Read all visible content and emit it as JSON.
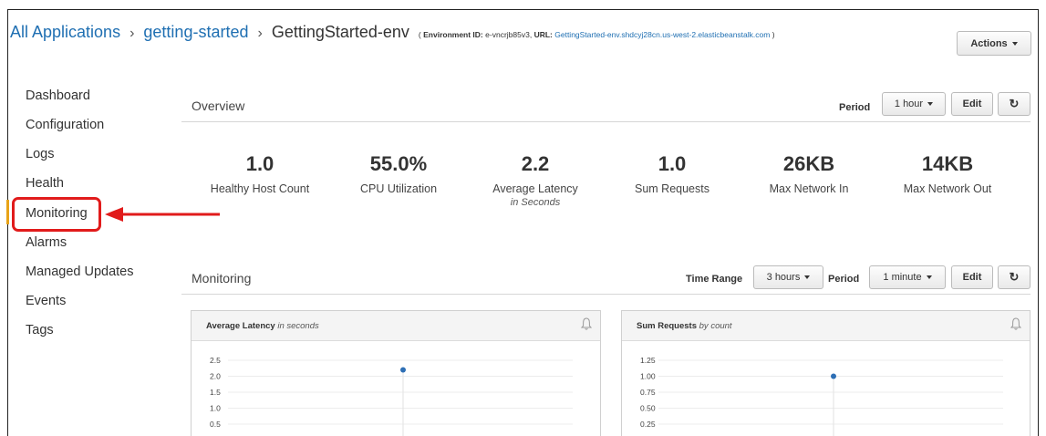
{
  "breadcrumb": {
    "root": "All Applications",
    "app": "getting-started",
    "current": "GettingStarted-env",
    "env_id_label": "Environment ID:",
    "env_id": "e-vncrjb85v3,",
    "url_label": "URL:",
    "url": "GettingStarted-env.shdcyj28cn.us-west-2.elasticbeanstalk.com",
    "open_paren": "(",
    "close_paren": ")"
  },
  "actions_label": "Actions",
  "sidebar": {
    "items": [
      {
        "label": "Dashboard"
      },
      {
        "label": "Configuration"
      },
      {
        "label": "Logs"
      },
      {
        "label": "Health"
      },
      {
        "label": "Monitoring",
        "active": true
      },
      {
        "label": "Alarms"
      },
      {
        "label": "Managed Updates"
      },
      {
        "label": "Events"
      },
      {
        "label": "Tags"
      }
    ]
  },
  "overview": {
    "title": "Overview",
    "period_label": "Period",
    "period_value": "1 hour",
    "edit_label": "Edit",
    "stats": [
      {
        "value": "1.0",
        "label": "Healthy Host Count",
        "sub": ""
      },
      {
        "value": "55.0%",
        "label": "CPU Utilization",
        "sub": ""
      },
      {
        "value": "2.2",
        "label": "Average Latency",
        "sub": "in Seconds"
      },
      {
        "value": "1.0",
        "label": "Sum Requests",
        "sub": ""
      },
      {
        "value": "26KB",
        "label": "Max Network In",
        "sub": ""
      },
      {
        "value": "14KB",
        "label": "Max Network Out",
        "sub": ""
      }
    ]
  },
  "monitoring": {
    "title": "Monitoring",
    "time_range_label": "Time Range",
    "time_range_value": "3 hours",
    "period_label": "Period",
    "period_value": "1 minute",
    "edit_label": "Edit"
  },
  "charts": [
    {
      "title": "Average Latency",
      "unit": "in seconds",
      "ticks": [
        "2.5",
        "2.0",
        "1.5",
        "1.0",
        "0.5"
      ],
      "point": 2.2
    },
    {
      "title": "Sum Requests",
      "unit": "by count",
      "ticks": [
        "1.25",
        "1.00",
        "0.75",
        "0.50",
        "0.25"
      ],
      "point": 1.0
    }
  ],
  "colors": {
    "link": "#1f6fb2",
    "highlight": "#e11b1b",
    "active_bar": "#e8a317",
    "point": "#2e6fb5"
  },
  "icons": {
    "refresh": "refresh-icon",
    "bell": "bell-icon",
    "caret": "caret-down-icon"
  }
}
